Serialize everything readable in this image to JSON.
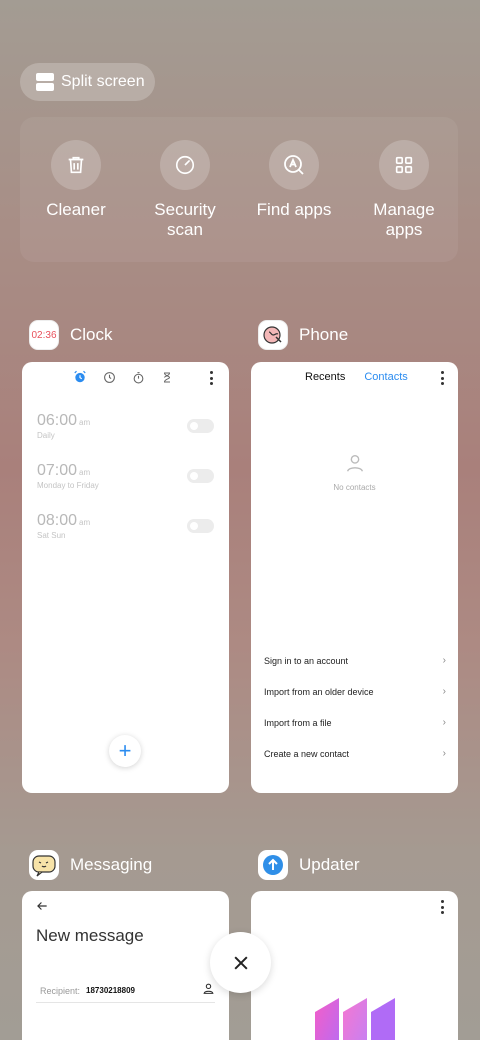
{
  "split_screen": {
    "label": "Split screen",
    "icon": "split-screen-icon"
  },
  "quick_actions": [
    {
      "label": "Cleaner",
      "icon": "trash-icon"
    },
    {
      "label": "Security\nscan",
      "icon": "security-scan-icon"
    },
    {
      "label": "Find apps",
      "icon": "find-apps-icon"
    },
    {
      "label": "Manage\napps",
      "icon": "grid-icon"
    }
  ],
  "apps": {
    "clock": {
      "name": "Clock",
      "icon_text": "02:36",
      "alarms": [
        {
          "time": "06:00",
          "ampm": "am",
          "days": "Daily"
        },
        {
          "time": "07:00",
          "ampm": "am",
          "days": "Monday to Friday"
        },
        {
          "time": "08:00",
          "ampm": "am",
          "days": "Sat Sun"
        }
      ],
      "fab": "+"
    },
    "phone": {
      "name": "Phone",
      "tabs": [
        "Recents",
        "Contacts"
      ],
      "active_tab": "Contacts",
      "empty_text": "No contacts",
      "actions": [
        "Sign in to an account",
        "Import from an older device",
        "Import from a file",
        "Create a new contact"
      ]
    },
    "messaging": {
      "name": "Messaging",
      "title": "New message",
      "recipient_label": "Recipient:",
      "recipient_value": "18730218809"
    },
    "updater": {
      "name": "Updater"
    }
  },
  "colors": {
    "accent": "#2b8cf0",
    "clock_icon_text": "#e8505b"
  }
}
